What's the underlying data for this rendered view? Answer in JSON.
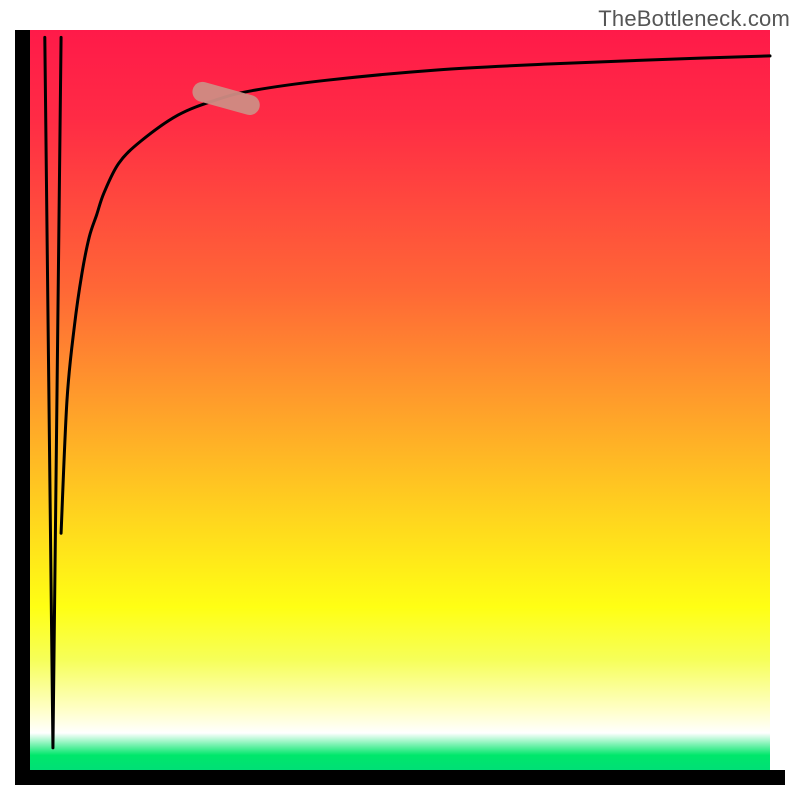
{
  "watermark": "TheBottleneck.com",
  "chart_data": {
    "type": "line",
    "title": "",
    "xlabel": "",
    "ylabel": "",
    "xlim": [
      0,
      100
    ],
    "ylim": [
      0,
      100
    ],
    "grid": false,
    "legend": false,
    "background_gradient": {
      "direction": "top-to-bottom",
      "stops": [
        {
          "pos": 0,
          "color": "#ff1a49"
        },
        {
          "pos": 50,
          "color": "#ff9c2b"
        },
        {
          "pos": 78,
          "color": "#ffff14"
        },
        {
          "pos": 95,
          "color": "#ffffff"
        },
        {
          "pos": 100,
          "color": "#00df76"
        }
      ]
    },
    "series": [
      {
        "name": "dip-segment",
        "x": [
          2.0,
          3.1,
          4.2
        ],
        "y": [
          99,
          3,
          99
        ],
        "style": "black-thin"
      },
      {
        "name": "main-curve",
        "x": [
          4.2,
          5,
          6,
          7,
          8,
          9,
          10,
          12,
          15,
          20,
          25,
          30,
          40,
          55,
          70,
          85,
          100
        ],
        "y": [
          32,
          50,
          60,
          67,
          72,
          75,
          78,
          82,
          85,
          88.5,
          90.5,
          91.8,
          93.2,
          94.6,
          95.4,
          96.0,
          96.5
        ],
        "style": "black-thin"
      }
    ],
    "annotations": [
      {
        "type": "highlight-segment",
        "shape": "rounded-bar",
        "color": "#cf8c84",
        "along_series": "main-curve",
        "x_range": [
          22,
          31
        ],
        "y_range": [
          89.5,
          92.0
        ]
      }
    ]
  }
}
